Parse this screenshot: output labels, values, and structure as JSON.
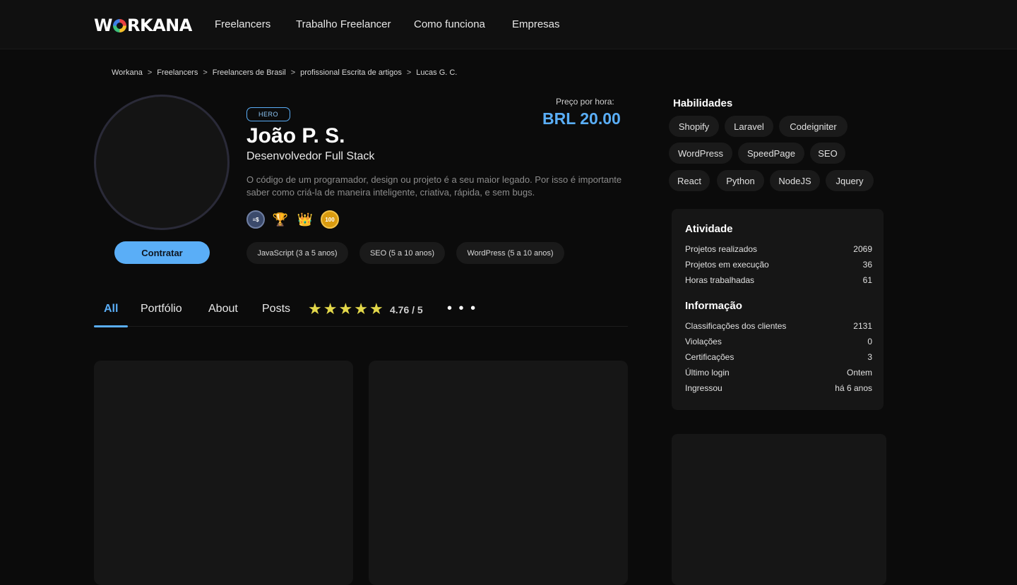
{
  "brand": {
    "logo_text_pre": "W",
    "logo_text_post": "RKANA"
  },
  "nav": {
    "items": [
      "Freelancers",
      "Trabalho Freelancer",
      "Como funciona",
      "Empresas"
    ]
  },
  "breadcrumb": [
    "Workana",
    "Freelancers",
    "Freelancers de Brasil",
    "profissional Escrita de artigos",
    "Lucas G. C."
  ],
  "breadcrumb_sep": ">",
  "profile": {
    "badge": "HERO",
    "name": "João P. S.",
    "role": "Desenvolvedor Full Stack",
    "bio": "O código de um programador, design ou projeto é a seu maior legado. Por isso é importante saber como criá-la de maneira inteligente, criativa, rápida, e sem bugs.",
    "price_label": "Preço por hora:",
    "price": "BRL 20.00",
    "hire_label": "Contratar",
    "badges": [
      {
        "icon": "dollar-badge-icon",
        "text": "≡$"
      },
      {
        "icon": "trophy-icon",
        "text": "🏆"
      },
      {
        "icon": "crown-icon",
        "text": "👑"
      },
      {
        "icon": "hundred-badge-icon",
        "text": "100"
      }
    ],
    "experience": [
      "JavaScript (3 a 5 anos)",
      "SEO (5 a 10 anos)",
      "WordPress (5 a 10 anos)"
    ]
  },
  "tabs": {
    "items": [
      "All",
      "Portfólio",
      "About",
      "Posts"
    ],
    "active": "All",
    "rating": "4.76 / 5",
    "stars": 5,
    "more": "• • •"
  },
  "skills": {
    "title": "Habilidades",
    "items": [
      "Shopify",
      "Laravel",
      "Codeigniter",
      "WordPress",
      "SpeedPage",
      "SEO",
      "React",
      "Python",
      "NodeJS",
      "Jquery"
    ]
  },
  "activity": {
    "title": "Atividade",
    "rows": [
      {
        "label": "Projetos realizados",
        "value": "2069"
      },
      {
        "label": "Projetos em execução",
        "value": "36"
      },
      {
        "label": "Horas trabalhadas",
        "value": "61"
      }
    ]
  },
  "info": {
    "title": "Informação",
    "rows": [
      {
        "label": "Classificações dos clientes",
        "value": "2131"
      },
      {
        "label": "Violações",
        "value": "0"
      },
      {
        "label": "Certificações",
        "value": "3"
      },
      {
        "label": "Último login",
        "value": "Ontem"
      },
      {
        "label": "Ingressou",
        "value": "há 6 anos"
      }
    ]
  },
  "colors": {
    "accent": "#5aaef7",
    "background": "#0b0b0b",
    "card": "#161616",
    "star": "#e3d84a"
  }
}
